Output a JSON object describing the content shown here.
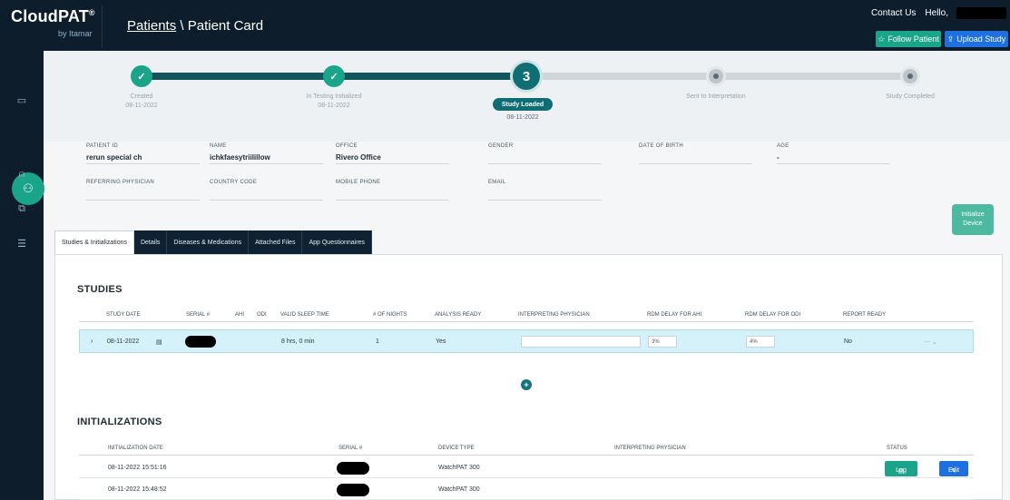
{
  "header": {
    "logo": "CloudPAT",
    "logo_mark": "®",
    "logo_sub": "by Itamar",
    "breadcrumb_link": "Patients",
    "breadcrumb_sep": " \\ ",
    "breadcrumb_current": "Patient Card",
    "contact_us": "Contact Us",
    "hello": "Hello,",
    "follow_button": "Follow Patient",
    "upload_button": "Upload Study"
  },
  "stepper": {
    "steps": [
      {
        "label": "Created",
        "date": "08-11-2022"
      },
      {
        "label": "In Testing Initialized",
        "date": "08-11-2022"
      },
      {
        "label": "Study Loaded",
        "date": "08-11-2022"
      },
      {
        "label": "Sent to Interpretation",
        "date": ""
      },
      {
        "label": "Study Completed",
        "date": ""
      }
    ],
    "current_number": "3",
    "done_mark": "✓"
  },
  "info": {
    "patient_id_label": "Patient ID",
    "patient_id": "rerun special ch",
    "name_label": "Name",
    "name": "ichkfaesytriilillow",
    "office_label": "Office",
    "office": "Rivero Office",
    "gender_label": "Gender",
    "gender": "",
    "dob_label": "Date of Birth",
    "dob": "",
    "age_label": "Age",
    "age": "-",
    "referring_label": "Referring Physician",
    "referring": "",
    "country_label": "Country Code",
    "country": "",
    "mobile_label": "Mobile Phone",
    "mobile": "",
    "email_label": "Email",
    "email": ""
  },
  "side_button": {
    "line1": "Initialize",
    "line2": "Device"
  },
  "tabs": [
    "Studies & Initializations",
    "Details",
    "Diseases & Medications",
    "Attached Files",
    "App Questionnaires"
  ],
  "studies": {
    "title": "STUDIES",
    "columns": [
      "Study Date",
      "Serial #",
      "AHI",
      "ODI",
      "Valid Sleep Time",
      "# of Nights",
      "Analysis Ready",
      "Interpreting Physician",
      "RDM Delay for AHI",
      "RDM Delay for ODI",
      "Report Ready"
    ],
    "row": {
      "expand": "›",
      "date": "08-11-2022",
      "valid_sleep": "8 hrs, 0 min",
      "nights": "1",
      "analysis_ready": "Yes",
      "rdm_ahi": "3%",
      "rdm_odi": "4%",
      "report_ready": "No"
    },
    "add": "+"
  },
  "initializations": {
    "title": "INITIALIZATIONS",
    "columns": [
      "Initialization Date",
      "Serial #",
      "Device Type",
      "Interpreting Physician",
      "Status"
    ],
    "rows": [
      {
        "date": "08-11-2022 15:51:16",
        "device": "WatchPAT 300"
      },
      {
        "date": "08-11-2022 15:48:52",
        "device": "WatchPAT 300"
      }
    ],
    "log_button": "Log",
    "edit_button": "Edit"
  },
  "colors": {
    "accent": "#1aa48a",
    "dark": "#0d1d2c",
    "primary": "#1e6fe0"
  }
}
